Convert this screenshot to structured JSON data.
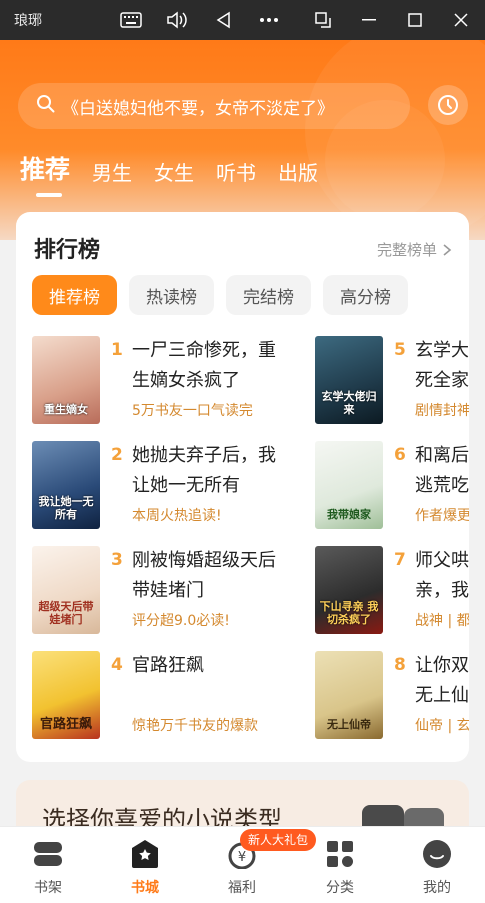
{
  "window": {
    "title": "琅琊",
    "buttons": [
      "keyboard-icon",
      "volume-icon",
      "back-icon",
      "more-icon",
      "screen-rotate-icon",
      "minimize-icon",
      "maximize-icon",
      "close-icon"
    ]
  },
  "search": {
    "placeholder": "《白送媳妇他不要，女帝不淡定了》"
  },
  "tabs": [
    "推荐",
    "男生",
    "女生",
    "听书",
    "出版"
  ],
  "ranking": {
    "title": "排行榜",
    "more": "完整榜单",
    "chips": [
      "推荐榜",
      "热读榜",
      "完结榜",
      "高分榜"
    ],
    "books": [
      {
        "rank": "1",
        "title": "一尸三命惨死，重生嫡女杀疯了",
        "desc": "5万书友一口气读完",
        "cover_text": "重生嫡女",
        "cover_color": "#e9c8b8"
      },
      {
        "rank": "2",
        "title": "她抛夫弃子后，我让她一无所有",
        "desc": "本周火热追读!",
        "cover_text": "我让她一无所有",
        "cover_color": "#2a4a78"
      },
      {
        "rank": "3",
        "title": "刚被悔婚超级天后带娃堵门",
        "desc": "评分超9.0必读!",
        "cover_text": "超级天后带娃堵门",
        "cover_color": "#f3e7dc"
      },
      {
        "rank": "4",
        "title": "官路狂飙",
        "desc": "惊艳万千书友的爆款",
        "cover_text": "官路狂飙",
        "cover_color": "#f2c230"
      },
      {
        "rank": "5",
        "title": "玄学大佬归来，怼死全家",
        "desc": "剧情封神",
        "cover_text": "玄学大佬归来",
        "cover_color": "#1f3a4a"
      },
      {
        "rank": "6",
        "title": "和离后，我带娘家逃荒吃香喝辣",
        "desc": "作者爆更",
        "cover_text": "我带娘家",
        "cover_color": "#e8efe7"
      },
      {
        "rank": "7",
        "title": "师父哄我下山寻亲，我找到了",
        "desc": "战神 | 都市",
        "cover_text": "下山寻亲 我切杀疯了",
        "cover_color": "#3a3a3a"
      },
      {
        "rank": "8",
        "title": "让你双修，你却成无上仙帝",
        "desc": "仙帝 | 玄幻",
        "cover_text": "无上仙帝",
        "cover_color": "#d9c58a"
      }
    ]
  },
  "promo": {
    "text": "选择你喜爱的小说类型"
  },
  "bottom_nav": {
    "items": [
      "书架",
      "书城",
      "福利",
      "分类",
      "我的"
    ],
    "active": "书城",
    "badge": "新人大礼包"
  },
  "colors": {
    "accent": "#ff7a18",
    "rank": "#f4a13a",
    "desc": "#d4892f"
  }
}
